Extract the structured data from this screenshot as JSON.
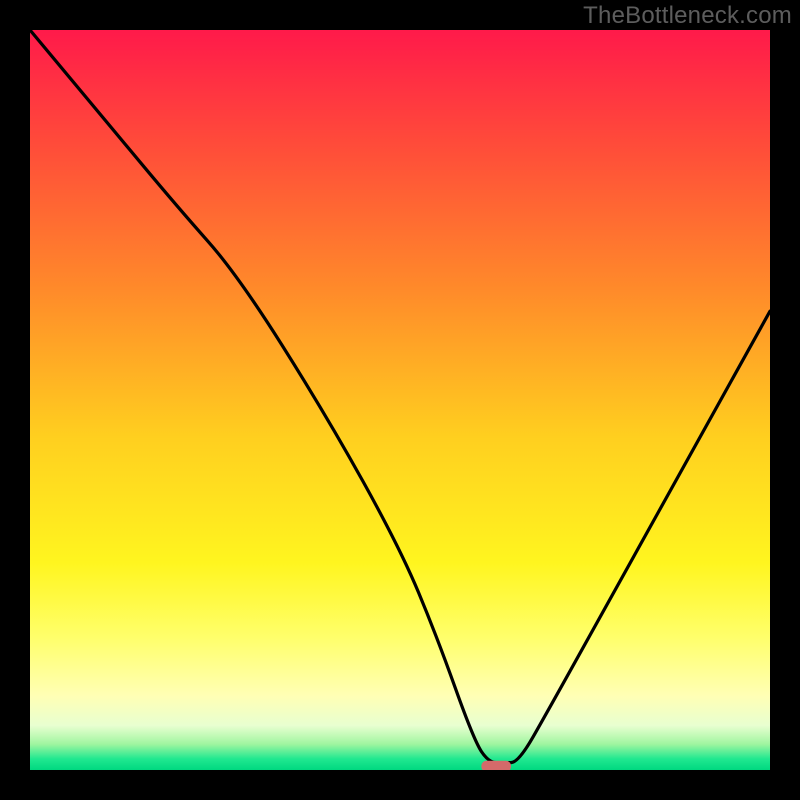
{
  "watermark": "TheBottleneck.com",
  "chart_data": {
    "type": "line",
    "title": "",
    "xlabel": "",
    "ylabel": "",
    "x_range": [
      0,
      100
    ],
    "y_range": [
      0,
      100
    ],
    "series": [
      {
        "name": "bottleneck-curve",
        "x": [
          0,
          10,
          20,
          28,
          40,
          50,
          55,
          60,
          62,
          64,
          66,
          70,
          80,
          90,
          100
        ],
        "y": [
          100,
          88,
          76,
          67,
          48,
          30,
          18,
          4,
          1,
          1,
          1,
          8,
          26,
          44,
          62
        ]
      }
    ],
    "marker": {
      "name": "optimal-marker",
      "x_center": 63,
      "y": 0.5,
      "color": "#d46a6a",
      "width": 4
    },
    "gradient_stops": [
      {
        "offset": 0.0,
        "color": "#ff1a4a"
      },
      {
        "offset": 0.15,
        "color": "#ff4a3a"
      },
      {
        "offset": 0.35,
        "color": "#ff8a2a"
      },
      {
        "offset": 0.55,
        "color": "#ffcf1f"
      },
      {
        "offset": 0.72,
        "color": "#fff51f"
      },
      {
        "offset": 0.82,
        "color": "#ffff6a"
      },
      {
        "offset": 0.9,
        "color": "#ffffb5"
      },
      {
        "offset": 0.94,
        "color": "#e8ffd0"
      },
      {
        "offset": 0.965,
        "color": "#a0f5a0"
      },
      {
        "offset": 0.985,
        "color": "#20e890"
      },
      {
        "offset": 1.0,
        "color": "#00d880"
      }
    ]
  }
}
